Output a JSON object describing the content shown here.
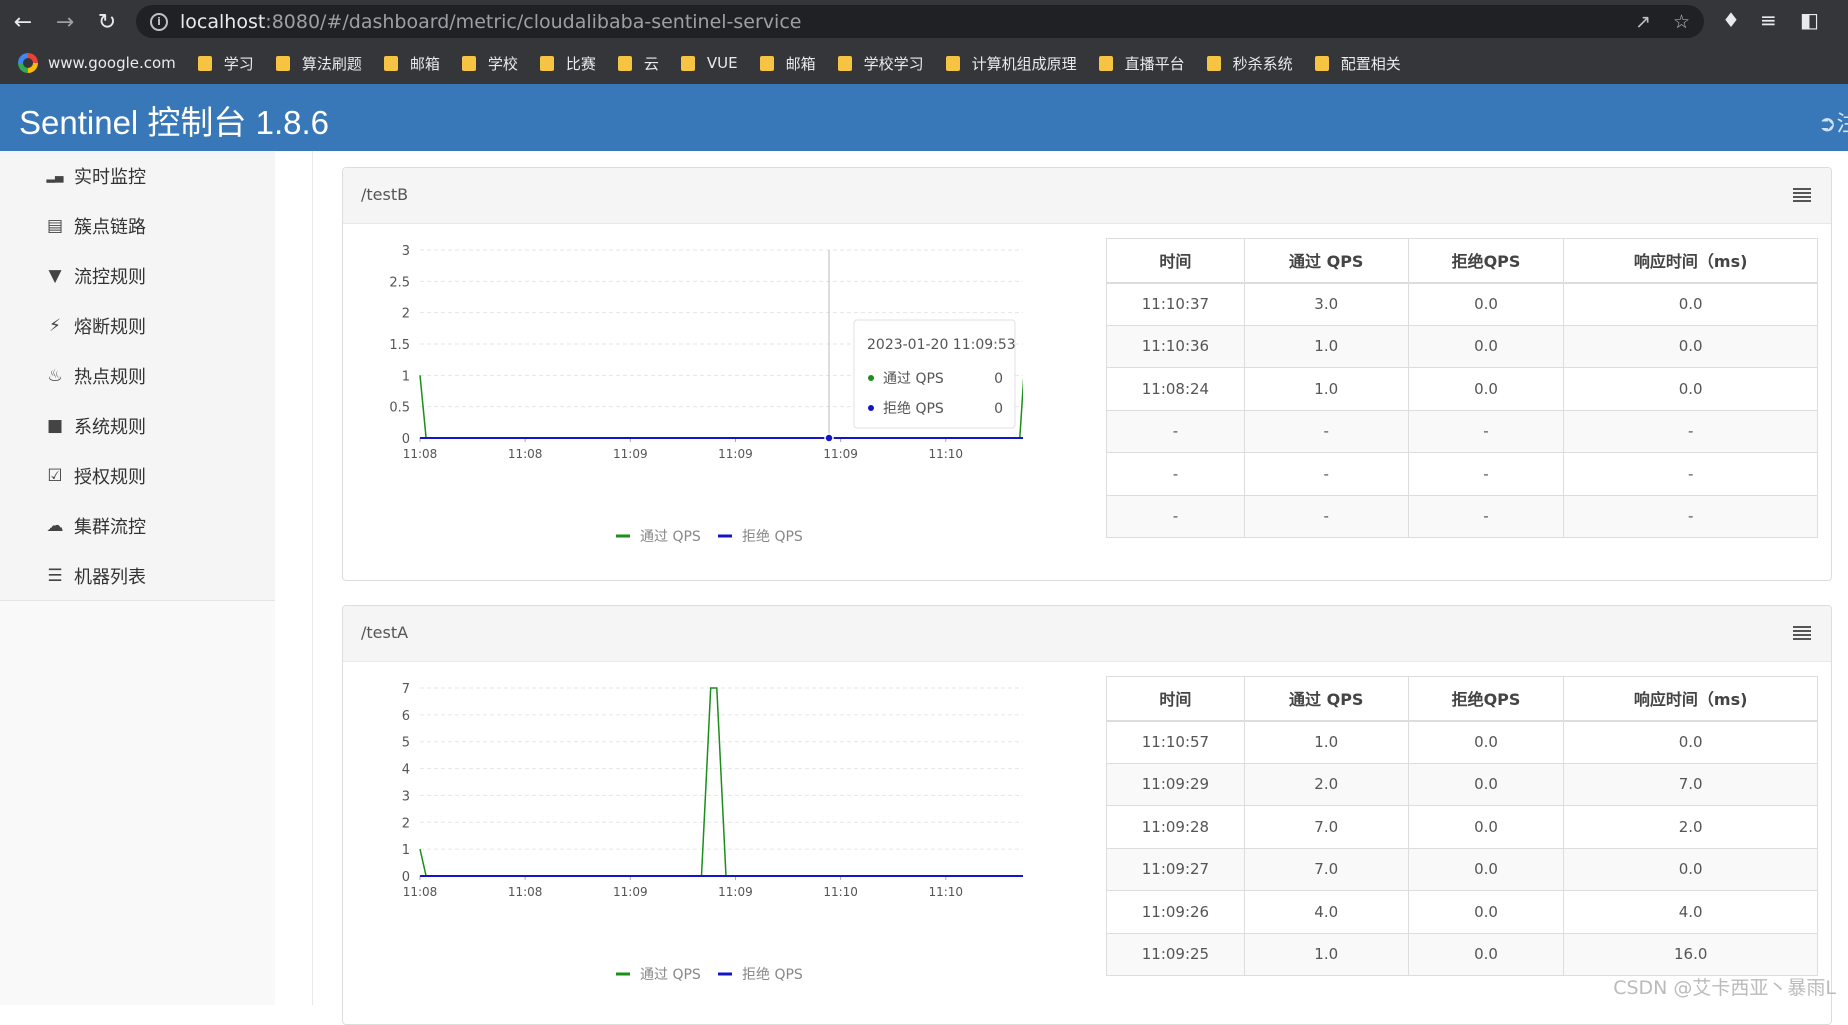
{
  "browser": {
    "url_host": "localhost",
    "url_rest": ":8080/#/dashboard/metric/cloudalibaba-sentinel-service",
    "bookmarks": [
      {
        "label": "www.google.com",
        "icon": "google-icon"
      },
      {
        "label": "学习",
        "icon": "folder-icon"
      },
      {
        "label": "算法刷题",
        "icon": "folder-icon"
      },
      {
        "label": "邮箱",
        "icon": "folder-icon"
      },
      {
        "label": "学校",
        "icon": "folder-icon"
      },
      {
        "label": "比赛",
        "icon": "folder-icon"
      },
      {
        "label": "云",
        "icon": "folder-icon"
      },
      {
        "label": "VUE",
        "icon": "folder-icon"
      },
      {
        "label": "邮箱",
        "icon": "folder-icon"
      },
      {
        "label": "学校学习",
        "icon": "folder-icon"
      },
      {
        "label": "计算机组成原理",
        "icon": "folder-icon"
      },
      {
        "label": "直播平台",
        "icon": "folder-icon"
      },
      {
        "label": "秒杀系统",
        "icon": "folder-icon"
      },
      {
        "label": "配置相关",
        "icon": "folder-icon"
      }
    ]
  },
  "header": {
    "brand": "Sentinel 控制台 1.8.6",
    "logout_label": "注"
  },
  "sidebar": {
    "items": [
      {
        "label": "实时监控",
        "icon": "bar-chart-icon"
      },
      {
        "label": "簇点链路",
        "icon": "list-icon"
      },
      {
        "label": "流控规则",
        "icon": "filter-icon"
      },
      {
        "label": "熔断规则",
        "icon": "bolt-icon"
      },
      {
        "label": "热点规则",
        "icon": "fire-icon"
      },
      {
        "label": "系统规则",
        "icon": "lock-icon"
      },
      {
        "label": "授权规则",
        "icon": "check-square-icon"
      },
      {
        "label": "集群流控",
        "icon": "cloud-icon"
      },
      {
        "label": "机器列表",
        "icon": "th-list-icon"
      }
    ]
  },
  "table_headers": [
    "时间",
    "通过 QPS",
    "拒绝QPS",
    "响应时间（ms)"
  ],
  "panels": [
    {
      "title": "/testB",
      "tooltip": {
        "time": "2023-01-20 11:09:53",
        "pass_label": "通过 QPS",
        "pass_value": "0",
        "block_label": "拒绝 QPS",
        "block_value": "0"
      },
      "rows": [
        [
          "11:10:37",
          "3.0",
          "0.0",
          "0.0"
        ],
        [
          "11:10:36",
          "1.0",
          "0.0",
          "0.0"
        ],
        [
          "11:08:24",
          "1.0",
          "0.0",
          "0.0"
        ],
        [
          "-",
          "-",
          "-",
          "-"
        ],
        [
          "-",
          "-",
          "-",
          "-"
        ],
        [
          "-",
          "-",
          "-",
          "-"
        ]
      ]
    },
    {
      "title": "/testA",
      "rows": [
        [
          "11:10:57",
          "1.0",
          "0.0",
          "0.0"
        ],
        [
          "11:09:29",
          "2.0",
          "0.0",
          "7.0"
        ],
        [
          "11:09:28",
          "7.0",
          "0.0",
          "2.0"
        ],
        [
          "11:09:27",
          "7.0",
          "0.0",
          "0.0"
        ],
        [
          "11:09:26",
          "4.0",
          "0.0",
          "4.0"
        ],
        [
          "11:09:25",
          "1.0",
          "0.0",
          "16.0"
        ]
      ]
    }
  ],
  "chart_data": [
    {
      "type": "line",
      "ylim": [
        0,
        3
      ],
      "yticks": [
        "0",
        "0.5",
        "1",
        "1.5",
        "2",
        "2.5",
        "3"
      ],
      "xticks": [
        "11:08",
        "11:08",
        "11:09",
        "11:09",
        "11:09",
        "11:10"
      ],
      "legend": "bottom-center",
      "series": [
        {
          "name": "通过 QPS",
          "color": "#1a8f1a",
          "points": [
            [
              0,
              1
            ],
            [
              0.01,
              0
            ],
            [
              0.98,
              0
            ],
            [
              1.0,
              3
            ]
          ]
        },
        {
          "name": "拒绝 QPS",
          "color": "#1515c8",
          "points": [
            [
              0,
              0
            ],
            [
              1.0,
              0
            ]
          ]
        }
      ]
    },
    {
      "type": "line",
      "ylim": [
        0,
        7
      ],
      "yticks": [
        "0",
        "1",
        "2",
        "3",
        "4",
        "5",
        "6",
        "7"
      ],
      "xticks": [
        "11:08",
        "11:08",
        "11:09",
        "11:09",
        "11:10",
        "11:10"
      ],
      "legend": "bottom-center",
      "series": [
        {
          "name": "通过 QPS",
          "color": "#1a8f1a",
          "points": [
            [
              0,
              1
            ],
            [
              0.01,
              0
            ],
            [
              0.46,
              0
            ],
            [
              0.475,
              7
            ],
            [
              0.485,
              7
            ],
            [
              0.5,
              0
            ],
            [
              0.99,
              0
            ],
            [
              1.0,
              1
            ]
          ]
        },
        {
          "name": "拒绝 QPS",
          "color": "#1515c8",
          "points": [
            [
              0,
              0
            ],
            [
              1.0,
              0
            ]
          ]
        }
      ]
    }
  ],
  "watermark": "CSDN @艾卡西亚丶暴雨L"
}
